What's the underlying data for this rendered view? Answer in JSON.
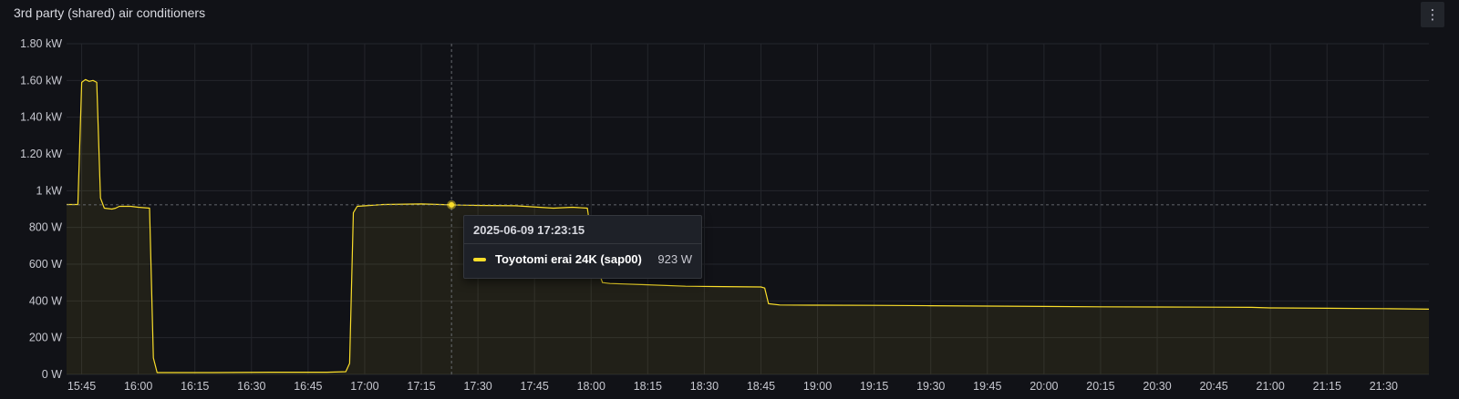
{
  "panel": {
    "title": "3rd party (shared) air conditioners",
    "menu_icon": "vertical-ellipsis-icon",
    "menu_glyph": "⋮"
  },
  "colors": {
    "background": "#111217",
    "grid": "#24262c",
    "series": "#fade2a",
    "fill": "rgba(250,222,42,0.07)",
    "tick_text": "#c7c8d0"
  },
  "chart_data": {
    "type": "line",
    "grid": true,
    "legend": "none",
    "ylim": [
      0,
      1800
    ],
    "xlim": [
      "15:41",
      "21:42"
    ],
    "yticks": [
      {
        "value": 0,
        "label": "0 W"
      },
      {
        "value": 200,
        "label": "200 W"
      },
      {
        "value": 400,
        "label": "400 W"
      },
      {
        "value": 600,
        "label": "600 W"
      },
      {
        "value": 800,
        "label": "800 W"
      },
      {
        "value": 1000,
        "label": "1 kW"
      },
      {
        "value": 1200,
        "label": "1.20 kW"
      },
      {
        "value": 1400,
        "label": "1.40 kW"
      },
      {
        "value": 1600,
        "label": "1.60 kW"
      },
      {
        "value": 1800,
        "label": "1.80 kW"
      }
    ],
    "xticks": [
      "15:45",
      "16:00",
      "16:15",
      "16:30",
      "16:45",
      "17:00",
      "17:15",
      "17:30",
      "17:45",
      "18:00",
      "18:15",
      "18:30",
      "18:45",
      "19:00",
      "19:15",
      "19:30",
      "19:45",
      "20:00",
      "20:15",
      "20:30",
      "20:45",
      "21:00",
      "21:15",
      "21:30"
    ],
    "series": [
      {
        "name": "Toyotomi erai 24K (sap00)",
        "points": [
          [
            "15:41",
            925
          ],
          [
            "15:44",
            925
          ],
          [
            "15:45",
            1590
          ],
          [
            "15:46",
            1605
          ],
          [
            "15:47",
            1595
          ],
          [
            "15:48",
            1600
          ],
          [
            "15:49",
            1590
          ],
          [
            "15:50",
            960
          ],
          [
            "15:51",
            905
          ],
          [
            "15:53",
            900
          ],
          [
            "15:54",
            905
          ],
          [
            "15:55",
            915
          ],
          [
            "15:58",
            915
          ],
          [
            "16:00",
            910
          ],
          [
            "16:03",
            905
          ],
          [
            "16:04",
            90
          ],
          [
            "16:05",
            10
          ],
          [
            "16:20",
            10
          ],
          [
            "16:35",
            12
          ],
          [
            "16:50",
            12
          ],
          [
            "16:55",
            15
          ],
          [
            "16:56",
            60
          ],
          [
            "16:57",
            880
          ],
          [
            "16:58",
            915
          ],
          [
            "17:05",
            925
          ],
          [
            "17:15",
            928
          ],
          [
            "17:23",
            923
          ],
          [
            "17:30",
            920
          ],
          [
            "17:40",
            918
          ],
          [
            "17:50",
            905
          ],
          [
            "17:55",
            910
          ],
          [
            "17:59",
            905
          ],
          [
            "18:01",
            620
          ],
          [
            "18:03",
            500
          ],
          [
            "18:05",
            495
          ],
          [
            "18:15",
            488
          ],
          [
            "18:25",
            480
          ],
          [
            "18:35",
            478
          ],
          [
            "18:45",
            476
          ],
          [
            "18:46",
            470
          ],
          [
            "18:47",
            385
          ],
          [
            "18:50",
            378
          ],
          [
            "19:00",
            377
          ],
          [
            "19:15",
            376
          ],
          [
            "19:30",
            374
          ],
          [
            "19:45",
            372
          ],
          [
            "20:00",
            370
          ],
          [
            "20:15",
            368
          ],
          [
            "20:30",
            367
          ],
          [
            "20:45",
            366
          ],
          [
            "20:55",
            365
          ],
          [
            "21:00",
            362
          ],
          [
            "21:15",
            360
          ],
          [
            "21:30",
            358
          ],
          [
            "21:42",
            355
          ]
        ]
      }
    ],
    "hover": {
      "time": "17:23",
      "value": 923
    }
  },
  "tooltip": {
    "timestamp": "2025-06-09 17:23:15",
    "series_name": "Toyotomi erai 24K (sap00)",
    "value_text": "923 W"
  }
}
